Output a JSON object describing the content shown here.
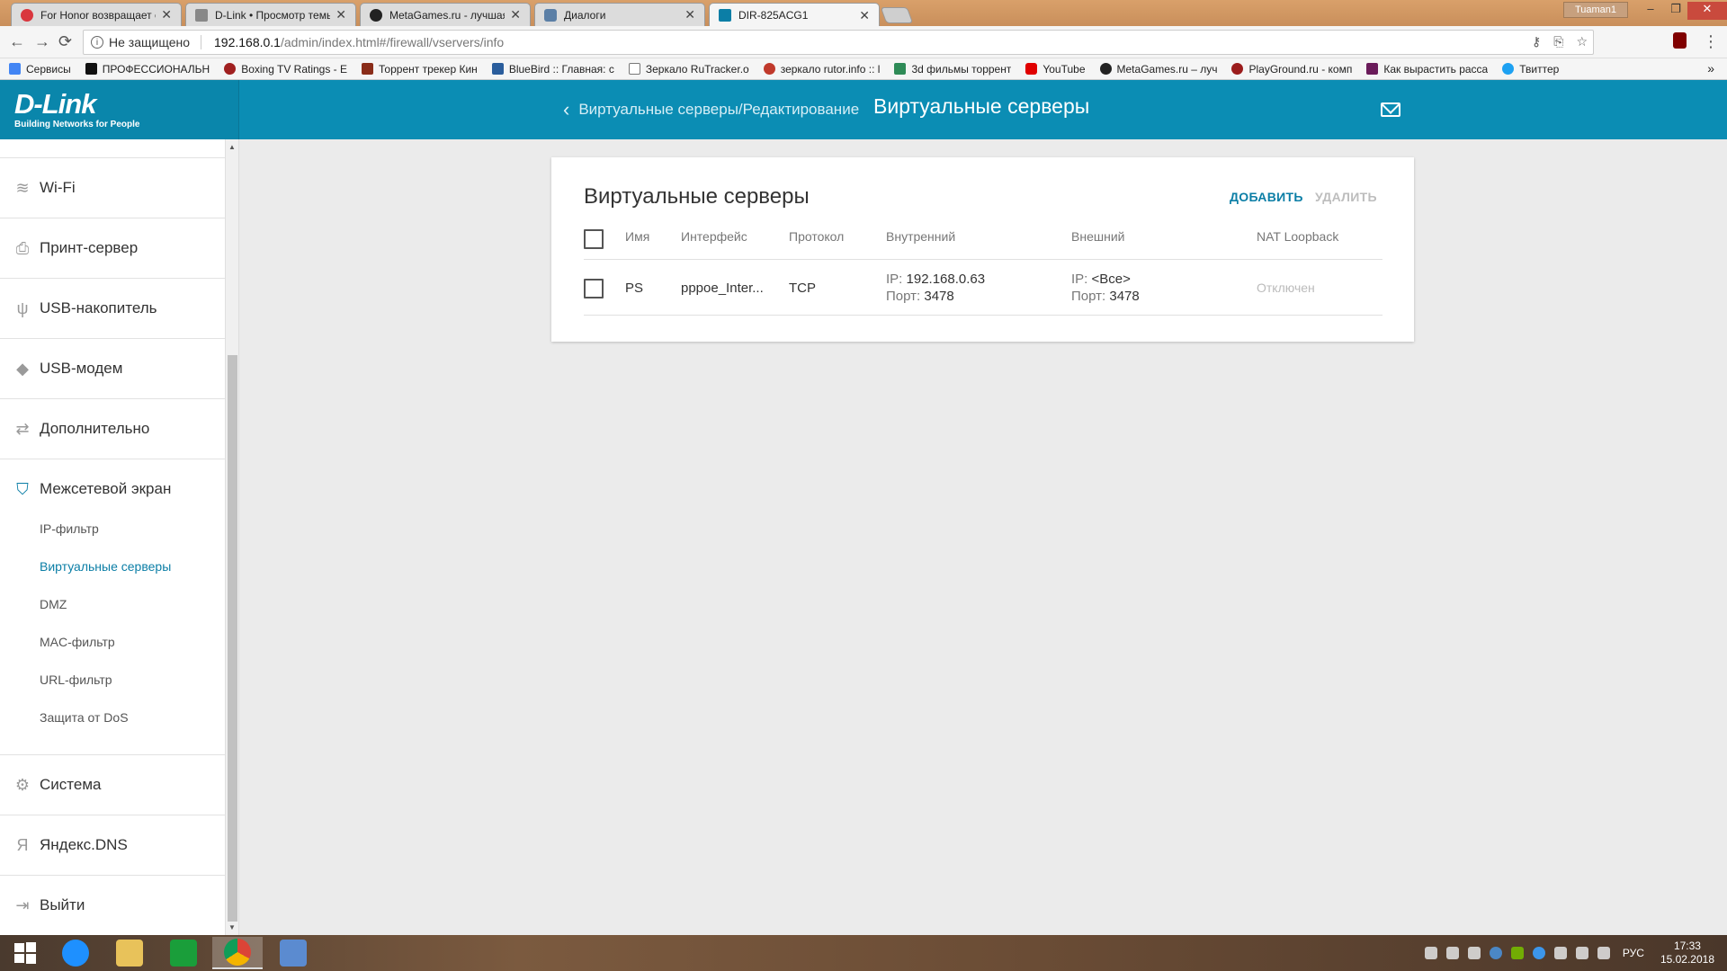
{
  "browser": {
    "tabs": [
      {
        "title": "For Honor возвращает с",
        "color": "#d9363e"
      },
      {
        "title": "D-Link • Просмотр темы",
        "color": "#888888"
      },
      {
        "title": "MetaGames.ru - лучшая",
        "color": "#222222"
      },
      {
        "title": "Диалоги",
        "color": "#5b7fa6"
      },
      {
        "title": "DIR-825ACG1",
        "color": "#0b7ea6"
      }
    ],
    "close_glyph": "✕",
    "user": "Tuaman1",
    "win_min": "–",
    "win_max": "❐",
    "win_close": "✕",
    "back": "←",
    "forward": "→",
    "reload": "⟳",
    "info_glyph": "i",
    "security": "Не защищено",
    "url_host": "192.168.0.1",
    "url_path": "/admin/index.html#/firewall/vservers/info",
    "omni_icons": [
      "⚷",
      "⎘",
      "☆"
    ],
    "menu": "⋮",
    "bookmarks": [
      {
        "label": "Сервисы",
        "color": "#4285f4"
      },
      {
        "label": "ПРОФЕССИОНАЛЬН",
        "color": "#111111"
      },
      {
        "label": "Boxing TV Ratings - E",
        "color": "#a02020"
      },
      {
        "label": "Торрент трекер Кин",
        "color": "#8a2d1a"
      },
      {
        "label": "BlueBird :: Главная: с",
        "color": "#2a5d9c"
      },
      {
        "label": "Зеркало RuTracker.o",
        "color": "#777777"
      },
      {
        "label": "зеркало rutor.info :: l",
        "color": "#c0392b"
      },
      {
        "label": "3d фильмы торрент",
        "color": "#2e8b57"
      },
      {
        "label": "YouTube",
        "color": "#e00000"
      },
      {
        "label": "MetaGames.ru – луч",
        "color": "#222222"
      },
      {
        "label": "PlayGround.ru - комп",
        "color": "#9b1c1c"
      },
      {
        "label": "Как вырастить расса",
        "color": "#6a1b5a"
      },
      {
        "label": "Твиттер",
        "color": "#1da1f2"
      }
    ],
    "more": "»"
  },
  "header": {
    "logo": "D-Link",
    "logo_tagline": "Building Networks for People",
    "back_chevron": "‹",
    "breadcrumb": "Виртуальные серверы/Редактирование",
    "title": "Виртуальные серверы"
  },
  "sidebar": {
    "items": [
      {
        "label": "Wi-Fi",
        "icon": "wifi-icon",
        "glyph": "≋"
      },
      {
        "label": "Принт-сервер",
        "icon": "printer-icon",
        "glyph": "⎙"
      },
      {
        "label": "USB-накопитель",
        "icon": "usb-icon",
        "glyph": "ψ"
      },
      {
        "label": "USB-модем",
        "icon": "modem-icon",
        "glyph": "◆"
      },
      {
        "label": "Дополнительно",
        "icon": "arrows-icon",
        "glyph": "⇄"
      },
      {
        "label": "Межсетевой экран",
        "icon": "shield-icon",
        "glyph": "⛉"
      },
      {
        "label": "Система",
        "icon": "gear-icon",
        "glyph": "⚙"
      },
      {
        "label": "Яндекс.DNS",
        "icon": "yandex-icon",
        "glyph": "Я"
      },
      {
        "label": "Выйти",
        "icon": "logout-icon",
        "glyph": "⇥"
      }
    ],
    "firewall_sub": [
      "IP-фильтр",
      "Виртуальные серверы",
      "DMZ",
      "MAC-фильтр",
      "URL-фильтр",
      "Защита от DoS"
    ]
  },
  "card": {
    "title": "Виртуальные серверы",
    "add": "ДОБАВИТЬ",
    "delete": "УДАЛИТЬ",
    "columns": [
      "Имя",
      "Интерфейс",
      "Протокол",
      "Внутренний",
      "Внешний",
      "NAT Loopback"
    ],
    "ip_label": "IP:",
    "port_label": "Порт:",
    "rows": [
      {
        "name": "PS",
        "interface": "pppoe_Inter...",
        "protocol": "TCP",
        "internal_ip": "192.168.0.63",
        "internal_port": "3478",
        "external_ip": "<Все>",
        "external_port": "3478",
        "nat_loopback": "Отключен"
      }
    ]
  },
  "taskbar": {
    "lang": "РУС",
    "time": "17:33",
    "date": "15.02.2018"
  },
  "colors": {
    "accent": "#0b8db4",
    "link": "#0b7ea6"
  }
}
